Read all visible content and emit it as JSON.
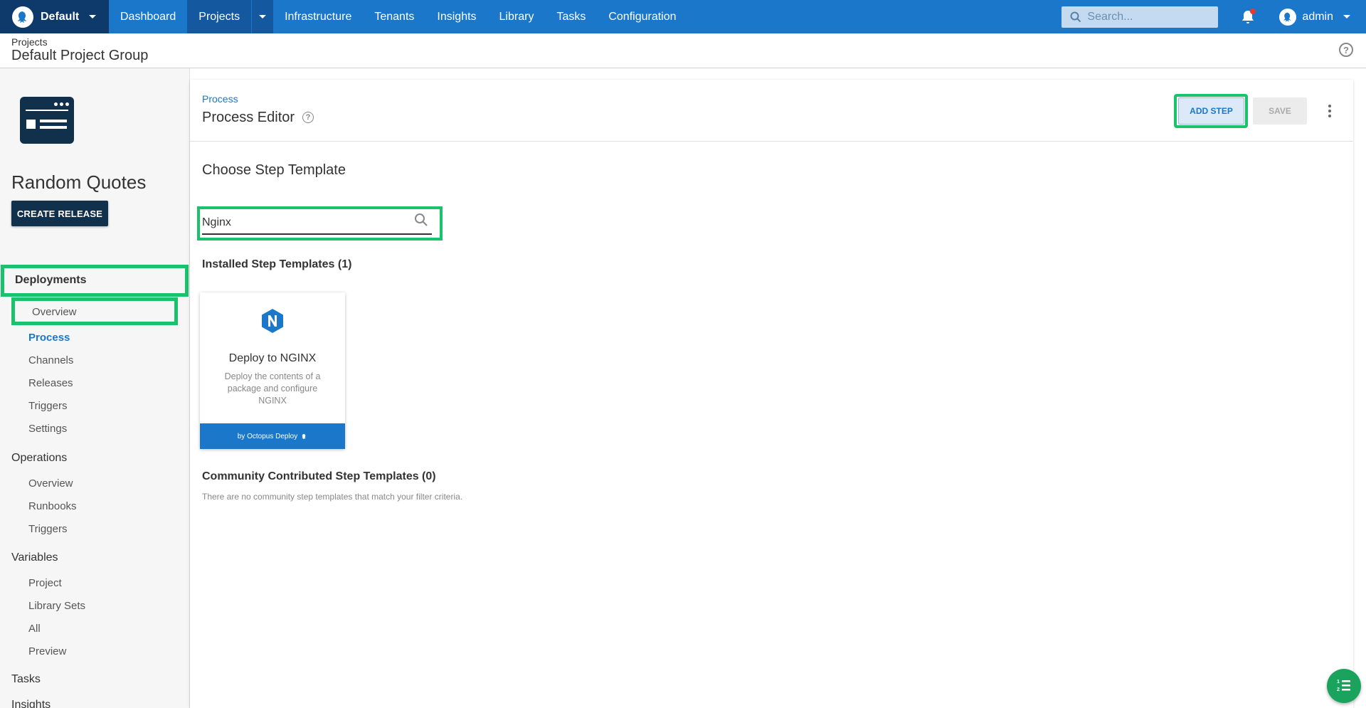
{
  "topbar": {
    "space_name": "Default",
    "nav": [
      "Dashboard",
      "Projects",
      "Infrastructure",
      "Tenants",
      "Insights",
      "Library",
      "Tasks",
      "Configuration"
    ],
    "active_nav": "Projects",
    "search_placeholder": "Search...",
    "user_name": "admin",
    "brand_color": "#1a77ca",
    "space_bg": "#0d3a6a"
  },
  "header": {
    "breadcrumb": "Projects",
    "group_title": "Default Project Group"
  },
  "sidebar": {
    "project_name": "Random Quotes",
    "create_release_label": "CREATE RELEASE",
    "sections": {
      "deployments": {
        "label": "Deployments",
        "items": [
          "Overview",
          "Process",
          "Channels",
          "Releases",
          "Triggers",
          "Settings"
        ],
        "active": "Process"
      },
      "operations": {
        "label": "Operations",
        "items": [
          "Overview",
          "Runbooks",
          "Triggers"
        ]
      },
      "variables": {
        "label": "Variables",
        "items": [
          "Project",
          "Library Sets",
          "All",
          "Preview"
        ]
      },
      "tasks": {
        "label": "Tasks"
      },
      "insights": {
        "label": "Insights"
      }
    }
  },
  "main": {
    "breadcrumb": "Process",
    "title": "Process Editor",
    "add_step_label": "ADD STEP",
    "save_label": "SAVE",
    "choose_title": "Choose Step Template",
    "filter_value": "Nginx",
    "installed_title": "Installed Step Templates (1)",
    "template": {
      "name": "Deploy to NGINX",
      "description": "Deploy the contents of a package and configure NGINX",
      "footer": "by Octopus Deploy",
      "icon": "nginx-logo"
    },
    "community_title": "Community Contributed Step Templates (0)",
    "community_note": "There are no community step templates that match your filter criteria.",
    "highlight_color": "#19c26b"
  }
}
